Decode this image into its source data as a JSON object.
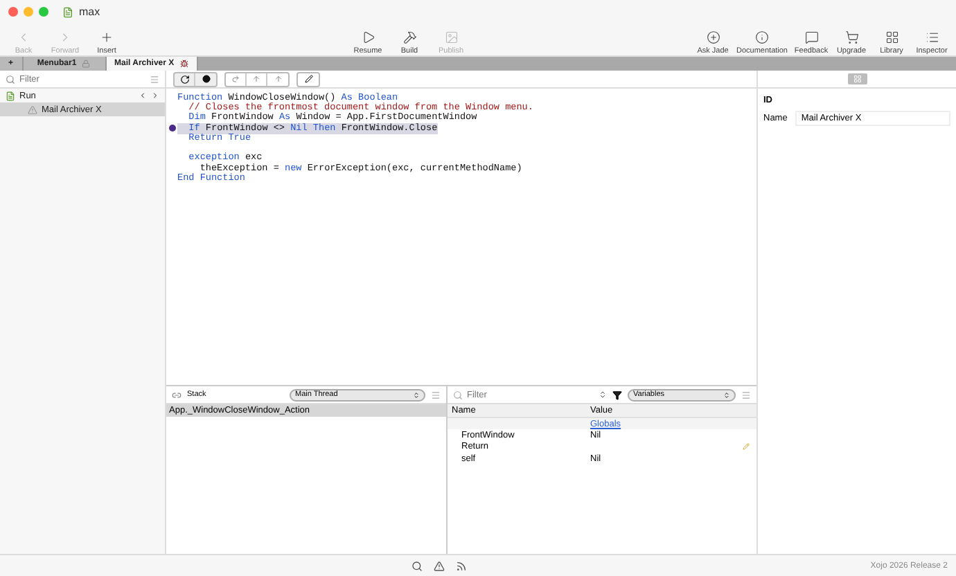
{
  "window": {
    "title": "max"
  },
  "toolbar": {
    "left": [
      {
        "label": "Back",
        "disabled": true
      },
      {
        "label": "Forward",
        "disabled": true
      },
      {
        "label": "Insert",
        "disabled": false
      }
    ],
    "center": [
      {
        "label": "Resume",
        "disabled": false
      },
      {
        "label": "Build",
        "disabled": false
      },
      {
        "label": "Publish",
        "disabled": true
      }
    ],
    "right": [
      {
        "label": "Ask Jade"
      },
      {
        "label": "Documentation"
      },
      {
        "label": "Feedback"
      },
      {
        "label": "Upgrade"
      },
      {
        "label": "Library"
      },
      {
        "label": "Inspector"
      }
    ]
  },
  "tabs": [
    {
      "label": "+",
      "kind": "add",
      "selected": false
    },
    {
      "label": "Menubar1",
      "kind": "locked",
      "selected": false
    },
    {
      "label": "Mail Archiver X",
      "kind": "bug",
      "selected": true
    }
  ],
  "navigator": {
    "filter_placeholder": "Filter",
    "items": [
      {
        "label": "Run",
        "selected": false,
        "children": [
          {
            "label": "Mail Archiver X",
            "selected": true
          }
        ]
      }
    ]
  },
  "code": {
    "lines": [
      {
        "breakpoint": false,
        "current": false,
        "tokens": [
          {
            "text": "Function",
            "kind": "keyword"
          },
          {
            "text": " WindowCloseWindow() ",
            "kind": "plain"
          },
          {
            "text": "As Boolean",
            "kind": "keyword"
          }
        ]
      },
      {
        "breakpoint": false,
        "current": false,
        "tokens": [
          {
            "text": "  // Closes the frontmost document window from the Window menu.",
            "kind": "comment"
          }
        ]
      },
      {
        "breakpoint": false,
        "current": false,
        "tokens": [
          {
            "text": "  Dim",
            "kind": "keyword"
          },
          {
            "text": " FrontWindow ",
            "kind": "plain"
          },
          {
            "text": "As",
            "kind": "keyword"
          },
          {
            "text": " Window = App.FirstDocumentWindow",
            "kind": "plain"
          }
        ]
      },
      {
        "breakpoint": true,
        "current": true,
        "tokens": [
          {
            "text": "  If",
            "kind": "keyword"
          },
          {
            "text": " FrontWindow <> ",
            "kind": "plain"
          },
          {
            "text": "Nil Then",
            "kind": "keyword"
          },
          {
            "text": " FrontWindow.Close",
            "kind": "plain"
          }
        ]
      },
      {
        "breakpoint": false,
        "current": false,
        "tokens": [
          {
            "text": "  Return True",
            "kind": "keyword"
          }
        ]
      },
      {
        "breakpoint": false
      },
      {
        "breakpoint": false,
        "current": false,
        "tokens": [
          {
            "text": "  exception",
            "kind": "keyword"
          },
          {
            "text": " exc",
            "kind": "plain"
          }
        ]
      },
      {
        "breakpoint": false,
        "current": false,
        "tokens": [
          {
            "text": "    theException = ",
            "kind": "plain"
          },
          {
            "text": "new",
            "kind": "keyword"
          },
          {
            "text": " ErrorException(exc, currentMethodName)",
            "kind": "plain"
          }
        ]
      },
      {
        "breakpoint": false,
        "current": false,
        "tokens": [
          {
            "text": "End Function",
            "kind": "keyword"
          }
        ]
      }
    ]
  },
  "inspector": {
    "section": "ID",
    "fields": [
      {
        "label": "Name",
        "value": "Mail Archiver X"
      }
    ]
  },
  "stack": {
    "title": "Stack",
    "thread": "Main Thread",
    "frames": [
      {
        "label": "App._WindowCloseWindow_Action",
        "selected": true
      }
    ]
  },
  "variables": {
    "filter_placeholder": "Filter",
    "scope": "Variables",
    "columns": [
      "Name",
      "Value"
    ],
    "rows": [
      {
        "kind": "link",
        "value": "Globals"
      },
      {
        "kind": "var",
        "name": "FrontWindow",
        "value": "Nil"
      },
      {
        "kind": "var",
        "name": "Return",
        "editable": true
      },
      {
        "kind": "var",
        "name": "self",
        "value": "Nil"
      }
    ]
  },
  "status_bar": {
    "version": "Xojo 2026 Release 2"
  }
}
